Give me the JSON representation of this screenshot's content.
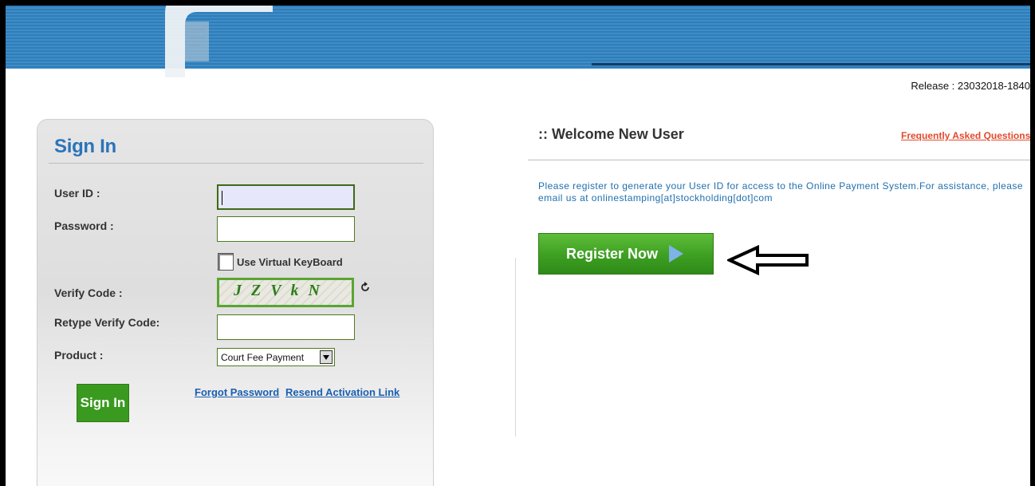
{
  "release": {
    "text": "Release : 23032018-1840"
  },
  "signin": {
    "title": "Sign In",
    "user_id_label": "User ID :",
    "password_label": "Password :",
    "virtual_keyboard_label": "Use Virtual KeyBoard",
    "verify_code_label": "Verify Code :",
    "captcha_text": "JZVkN",
    "retype_label": "Retype Verify Code:",
    "product_label": "Product :",
    "product_value": "Court Fee Payment",
    "button_label": "Sign In",
    "forgot_password": "Forgot Password",
    "resend_activation": "Resend Activation Link"
  },
  "welcome": {
    "title": ":: Welcome New User",
    "faq": "Frequently Asked Questions",
    "text": "Please register to generate your User ID for access to the Online Payment System.For assistance, please email us at onlinestamping[at]stockholding[dot]com",
    "register_label": "Register Now"
  },
  "icons": {
    "refresh": "refresh-icon",
    "play": "play-icon",
    "arrow": "left-arrow-icon"
  },
  "colors": {
    "banner": "#3f8cc6",
    "title_blue": "#2a74ba",
    "button_green": "#3a9a1f",
    "link_blue": "#1a5fb0",
    "faq_red": "#e14b2c"
  }
}
